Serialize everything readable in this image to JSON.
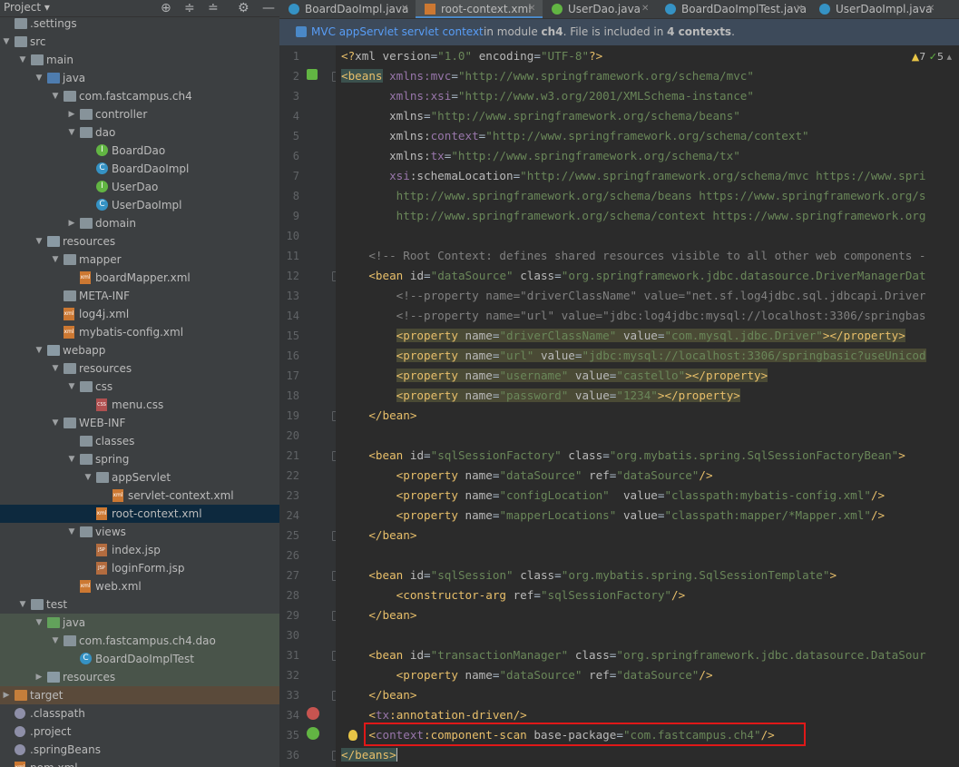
{
  "project": {
    "title": "Project",
    "tree": [
      {
        "indent": 0,
        "arrow": "",
        "icon": "folder",
        "label": ".settings"
      },
      {
        "indent": 0,
        "arrow": "down",
        "icon": "folder",
        "label": "src"
      },
      {
        "indent": 1,
        "arrow": "down",
        "icon": "folder",
        "label": "main"
      },
      {
        "indent": 2,
        "arrow": "down",
        "icon": "folder-src",
        "label": "java"
      },
      {
        "indent": 3,
        "arrow": "down",
        "icon": "folder",
        "label": "com.fastcampus.ch4"
      },
      {
        "indent": 4,
        "arrow": "right",
        "icon": "folder",
        "label": "controller"
      },
      {
        "indent": 4,
        "arrow": "down",
        "icon": "folder",
        "label": "dao"
      },
      {
        "indent": 5,
        "arrow": "",
        "icon": "interface",
        "label": "BoardDao"
      },
      {
        "indent": 5,
        "arrow": "",
        "icon": "class",
        "label": "BoardDaoImpl"
      },
      {
        "indent": 5,
        "arrow": "",
        "icon": "interface",
        "label": "UserDao"
      },
      {
        "indent": 5,
        "arrow": "",
        "icon": "class",
        "label": "UserDaoImpl"
      },
      {
        "indent": 4,
        "arrow": "right",
        "icon": "folder",
        "label": "domain"
      },
      {
        "indent": 2,
        "arrow": "down",
        "icon": "folder-res",
        "label": "resources"
      },
      {
        "indent": 3,
        "arrow": "down",
        "icon": "folder",
        "label": "mapper"
      },
      {
        "indent": 4,
        "arrow": "",
        "icon": "xml",
        "label": "boardMapper.xml"
      },
      {
        "indent": 3,
        "arrow": "",
        "icon": "folder",
        "label": "META-INF"
      },
      {
        "indent": 3,
        "arrow": "",
        "icon": "xml",
        "label": "log4j.xml"
      },
      {
        "indent": 3,
        "arrow": "",
        "icon": "xml",
        "label": "mybatis-config.xml"
      },
      {
        "indent": 2,
        "arrow": "down",
        "icon": "folder-res",
        "label": "webapp"
      },
      {
        "indent": 3,
        "arrow": "down",
        "icon": "folder",
        "label": "resources"
      },
      {
        "indent": 4,
        "arrow": "down",
        "icon": "folder",
        "label": "css"
      },
      {
        "indent": 5,
        "arrow": "",
        "icon": "css",
        "label": "menu.css"
      },
      {
        "indent": 3,
        "arrow": "down",
        "icon": "folder",
        "label": "WEB-INF"
      },
      {
        "indent": 4,
        "arrow": "",
        "icon": "folder",
        "label": "classes"
      },
      {
        "indent": 4,
        "arrow": "down",
        "icon": "folder",
        "label": "spring"
      },
      {
        "indent": 5,
        "arrow": "down",
        "icon": "folder",
        "label": "appServlet"
      },
      {
        "indent": 6,
        "arrow": "",
        "icon": "xml",
        "label": "servlet-context.xml"
      },
      {
        "indent": 5,
        "arrow": "",
        "icon": "xml",
        "label": "root-context.xml",
        "selected": true
      },
      {
        "indent": 4,
        "arrow": "down",
        "icon": "folder",
        "label": "views"
      },
      {
        "indent": 5,
        "arrow": "",
        "icon": "jsp",
        "label": "index.jsp"
      },
      {
        "indent": 5,
        "arrow": "",
        "icon": "jsp",
        "label": "loginForm.jsp"
      },
      {
        "indent": 4,
        "arrow": "",
        "icon": "xml",
        "label": "web.xml"
      },
      {
        "indent": 1,
        "arrow": "down",
        "icon": "folder",
        "label": "test"
      },
      {
        "indent": 2,
        "arrow": "down",
        "icon": "folder-green",
        "label": "java",
        "test": true
      },
      {
        "indent": 3,
        "arrow": "down",
        "icon": "folder",
        "label": "com.fastcampus.ch4.dao",
        "test": true
      },
      {
        "indent": 4,
        "arrow": "",
        "icon": "class",
        "label": "BoardDaoImplTest",
        "test": true
      },
      {
        "indent": 2,
        "arrow": "right",
        "icon": "folder-res",
        "label": "resources",
        "test": true
      },
      {
        "indent": 0,
        "arrow": "right",
        "icon": "folder-orange",
        "label": "target",
        "target": true
      },
      {
        "indent": 0,
        "arrow": "",
        "icon": "dot",
        "label": ".classpath"
      },
      {
        "indent": 0,
        "arrow": "",
        "icon": "dot",
        "label": ".project"
      },
      {
        "indent": 0,
        "arrow": "",
        "icon": "dot",
        "label": ".springBeans"
      },
      {
        "indent": 0,
        "arrow": "",
        "icon": "xml",
        "label": "pom.xml"
      }
    ]
  },
  "tabs": [
    {
      "label": "BoardDaoImpl.java",
      "icon": "class"
    },
    {
      "label": "root-context.xml",
      "icon": "xml",
      "active": true
    },
    {
      "label": "UserDao.java",
      "icon": "interface"
    },
    {
      "label": "BoardDaoImplTest.java",
      "icon": "class"
    },
    {
      "label": "UserDaoImpl.java",
      "icon": "class"
    }
  ],
  "banner": {
    "link": "MVC appServlet servlet context",
    "text_prefix": "in module ",
    "module": "ch4",
    "text_mid": ". File is included in ",
    "contexts": "4 contexts",
    "text_suffix": "."
  },
  "inspections": {
    "warnings": "7",
    "ok": "5"
  },
  "code_lines": [
    {
      "n": "1",
      "html": "<span style='color:#e8bf6a'>&lt;?</span><span style='color:#bababa'>xml version</span>=<span style='color:#6a8759'>\"1.0\"</span> <span style='color:#bababa'>encoding</span>=<span style='color:#6a8759'>\"UTF-8\"</span><span style='color:#e8bf6a'>?&gt;</span>"
    },
    {
      "n": "2",
      "html": "<span style='color:#e8bf6a;background:#3b514d'>&lt;beans</span> <span style='color:#9876aa'>xmlns:mvc</span>=<span style='color:#6a8759'>\"http://www.springframework.org/schema/mvc\"</span>"
    },
    {
      "n": "3",
      "html": "       <span style='color:#9876aa'>xmlns:xsi</span>=<span style='color:#6a8759'>\"http://www.w3.org/2001/XMLSchema-instance\"</span>"
    },
    {
      "n": "4",
      "html": "       <span style='color:#bababa'>xmlns</span>=<span style='color:#6a8759'>\"http://www.springframework.org/schema/beans\"</span>"
    },
    {
      "n": "5",
      "html": "       <span style='color:#bababa'>xmlns:</span><span style='color:#9876aa'>context</span>=<span style='color:#6a8759'>\"http://www.springframework.org/schema/context\"</span>"
    },
    {
      "n": "6",
      "html": "       <span style='color:#bababa'>xmlns:</span><span style='color:#9876aa'>tx</span>=<span style='color:#6a8759'>\"http://www.springframework.org/schema/tx\"</span>"
    },
    {
      "n": "7",
      "html": "       <span style='color:#9876aa'>xsi</span><span style='color:#bababa'>:schemaLocation</span>=<span style='color:#6a8759'>\"http://www.springframework.org/schema/mvc https://www.spri</span>"
    },
    {
      "n": "8",
      "html": "<span style='color:#6a8759'>        http://www.springframework.org/schema/beans https://www.springframework.org/s</span>"
    },
    {
      "n": "9",
      "html": "<span style='color:#6a8759'>        http://www.springframework.org/schema/context https://www.springframework.org</span>"
    },
    {
      "n": "10",
      "html": ""
    },
    {
      "n": "11",
      "html": "    <span style='color:#808080'>&lt;!-- Root Context: defines shared resources visible to all other web components -</span>"
    },
    {
      "n": "12",
      "html": "    <span style='color:#e8bf6a'>&lt;bean</span> <span style='color:#bababa'>id</span>=<span style='color:#6a8759'>\"dataSource\"</span> <span style='color:#bababa'>class</span>=<span style='color:#6a8759'>\"org.springframework.jdbc.datasource.DriverManagerDat</span>"
    },
    {
      "n": "13",
      "html": "        <span style='color:#808080'>&lt;!--property name=\"driverClassName\" value=\"net.sf.log4jdbc.sql.jdbcapi.Driver</span>"
    },
    {
      "n": "14",
      "html": "        <span style='color:#808080'>&lt;!--property name=\"url\" value=\"jdbc:log4jdbc:mysql://localhost:3306/springbas</span>"
    },
    {
      "n": "15",
      "hl": true,
      "html": "        <span class='hl'><span style='color:#e8bf6a'>&lt;property</span> <span style='color:#bababa'>name</span>=<span style='color:#6a8759'>\"driverClassName\"</span> <span style='color:#bababa'>value</span>=<span style='color:#6a8759'>\"com.mysql.jdbc.Driver\"</span><span style='color:#e8bf6a'>&gt;&lt;/property&gt;</span></span>"
    },
    {
      "n": "16",
      "hl": true,
      "html": "        <span class='hl'><span style='color:#e8bf6a'>&lt;property</span> <span style='color:#bababa'>name</span>=<span style='color:#6a8759'>\"url\"</span> <span style='color:#bababa'>value</span>=<span style='color:#6a8759'>\"jdbc:mysql://localhost:3306/springbasic?useUnicod</span></span>"
    },
    {
      "n": "17",
      "hl": true,
      "html": "        <span class='hl'><span style='color:#e8bf6a'>&lt;property</span> <span style='color:#bababa'>name</span>=<span style='color:#6a8759'>\"username\"</span> <span style='color:#bababa'>value</span>=<span style='color:#6a8759'>\"castello\"</span><span style='color:#e8bf6a'>&gt;&lt;/property&gt;</span></span>"
    },
    {
      "n": "18",
      "hl": true,
      "html": "        <span class='hl'><span style='color:#e8bf6a'>&lt;property</span> <span style='color:#bababa'>name</span>=<span style='color:#6a8759'>\"password\"</span> <span style='color:#bababa'>value</span>=<span style='color:#6a8759'>\"1234\"</span><span style='color:#e8bf6a'>&gt;&lt;/property&gt;</span></span>"
    },
    {
      "n": "19",
      "html": "    <span style='color:#e8bf6a'>&lt;/bean&gt;</span>"
    },
    {
      "n": "20",
      "html": ""
    },
    {
      "n": "21",
      "html": "    <span style='color:#e8bf6a'>&lt;bean</span> <span style='color:#bababa'>id</span>=<span style='color:#6a8759'>\"sqlSessionFactory\"</span> <span style='color:#bababa'>class</span>=<span style='color:#6a8759'>\"org.mybatis.spring.SqlSessionFactoryBean\"</span><span style='color:#e8bf6a'>&gt;</span>"
    },
    {
      "n": "22",
      "html": "        <span style='color:#e8bf6a'>&lt;property</span> <span style='color:#bababa'>name</span>=<span style='color:#6a8759'>\"dataSource\"</span> <span style='color:#bababa'>ref</span>=<span style='color:#6a8759'>\"dataSource\"</span><span style='color:#e8bf6a'>/&gt;</span>"
    },
    {
      "n": "23",
      "html": "        <span style='color:#e8bf6a'>&lt;property</span> <span style='color:#bababa'>name</span>=<span style='color:#6a8759'>\"configLocation\"</span>  <span style='color:#bababa'>value</span>=<span style='color:#6a8759'>\"classpath:mybatis-config.xml\"</span><span style='color:#e8bf6a'>/&gt;</span>"
    },
    {
      "n": "24",
      "html": "        <span style='color:#e8bf6a'>&lt;property</span> <span style='color:#bababa'>name</span>=<span style='color:#6a8759'>\"mapperLocations\"</span> <span style='color:#bababa'>value</span>=<span style='color:#6a8759'>\"classpath:mapper/*Mapper.xml\"</span><span style='color:#e8bf6a'>/&gt;</span>"
    },
    {
      "n": "25",
      "html": "    <span style='color:#e8bf6a'>&lt;/bean&gt;</span>"
    },
    {
      "n": "26",
      "html": ""
    },
    {
      "n": "27",
      "html": "    <span style='color:#e8bf6a'>&lt;bean</span> <span style='color:#bababa'>id</span>=<span style='color:#6a8759'>\"sqlSession\"</span> <span style='color:#bababa'>class</span>=<span style='color:#6a8759'>\"org.mybatis.spring.SqlSessionTemplate\"</span><span style='color:#e8bf6a'>&gt;</span>"
    },
    {
      "n": "28",
      "html": "        <span style='color:#e8bf6a'>&lt;constructor-arg</span> <span style='color:#bababa'>ref</span>=<span style='color:#6a8759'>\"sqlSessionFactory\"</span><span style='color:#e8bf6a'>/&gt;</span>"
    },
    {
      "n": "29",
      "html": "    <span style='color:#e8bf6a'>&lt;/bean&gt;</span>"
    },
    {
      "n": "30",
      "html": ""
    },
    {
      "n": "31",
      "html": "    <span style='color:#e8bf6a'>&lt;bean</span> <span style='color:#bababa'>id</span>=<span style='color:#6a8759'>\"transactionManager\"</span> <span style='color:#bababa'>class</span>=<span style='color:#6a8759'>\"org.springframework.jdbc.datasource.DataSour</span>"
    },
    {
      "n": "32",
      "html": "        <span style='color:#e8bf6a'>&lt;property</span> <span style='color:#bababa'>name</span>=<span style='color:#6a8759'>\"dataSource\"</span> <span style='color:#bababa'>ref</span>=<span style='color:#6a8759'>\"dataSource\"</span><span style='color:#e8bf6a'>/&gt;</span>"
    },
    {
      "n": "33",
      "html": "    <span style='color:#e8bf6a'>&lt;/bean&gt;</span>"
    },
    {
      "n": "34",
      "html": "    <span style='color:#e8bf6a'>&lt;</span><span style='color:#9876aa'>tx</span><span style='color:#e8bf6a'>:annotation-driven/&gt;</span>"
    },
    {
      "n": "35",
      "html": "    <span style='color:#e8bf6a'>&lt;</span><span style='color:#9876aa'>context</span><span style='color:#e8bf6a'>:component-scan</span> <span style='color:#bababa'>base-package</span>=<span style='color:#6a8759'>\"com.fastcampus.ch4\"</span><span style='color:#e8bf6a'>/&gt;</span>"
    },
    {
      "n": "36",
      "html": "<span style='color:#e8bf6a;background:#3b514d'>&lt;/beans&gt;</span><span style='border-left:1px solid #bbbbbb'></span>"
    }
  ],
  "colors": {
    "panel": "#3c3f41",
    "editor": "#2b2b2b",
    "gutter": "#313335",
    "highlight_box": "#e01818"
  }
}
